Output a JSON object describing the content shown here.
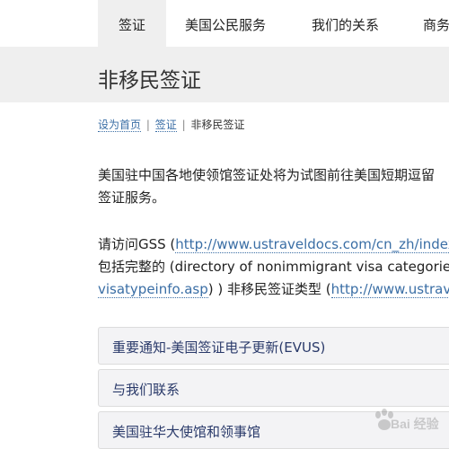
{
  "nav": {
    "tabs": [
      "签证",
      "美国公民服务",
      "我们的关系",
      "商务"
    ]
  },
  "page": {
    "title": "非移民签证"
  },
  "breadcrumb": {
    "home": "设为首页",
    "sep1": "|",
    "visa": "签证",
    "sep2": "|",
    "current": "非移民签证"
  },
  "content": {
    "para1_line1": "美国驻中国各地使领馆签证处将为试图前往美国短期逗留",
    "para1_line2": "签证服务。",
    "para2_line1_text": "请访问GSS (",
    "para2_line1_link": "http://www.ustraveldocs.com/cn_zh/index",
    "para2_line2_text": "包括完整的 (directory of nonimmigrant visa categories (",
    "para2_line3_link": "visatypeinfo.asp",
    "para2_line3_text": ") ) 非移民签证类型 (",
    "para2_line3_link2": "http://www.ustrave"
  },
  "accordion": {
    "items": [
      "重要通知-美国签证电子更新(EVUS)",
      "与我们联系",
      "美国驻华大使馆和领事馆"
    ]
  },
  "watermark": {
    "text": "Bai 经验"
  },
  "colors": {
    "link": "#3a6ea5",
    "banner": "#efefef",
    "accordion_bg": "#f3f3f5",
    "accordion_text": "#2a3a6a"
  }
}
